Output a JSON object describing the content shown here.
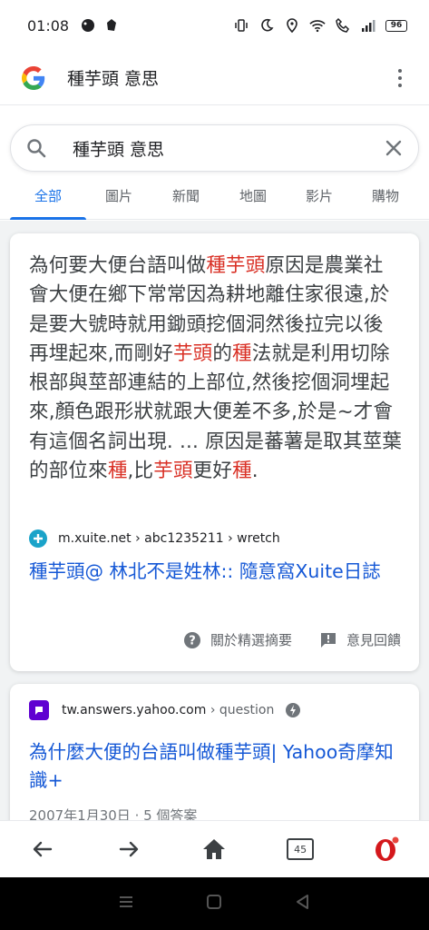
{
  "status_bar": {
    "time": "01:08",
    "battery": "96"
  },
  "header": {
    "query": "種芋頭 意思"
  },
  "search": {
    "value": "種芋頭 意思"
  },
  "tabs": [
    {
      "label": "全部"
    },
    {
      "label": "圖片"
    },
    {
      "label": "新聞"
    },
    {
      "label": "地圖"
    },
    {
      "label": "影片"
    },
    {
      "label": "購物"
    }
  ],
  "result1": {
    "snippet": [
      {
        "t": "為何要大便台語叫做"
      },
      {
        "t": "種芋頭",
        "hl": true
      },
      {
        "t": "原因是農業社會大便在鄉下常常因為耕地離住家很遠,於是要大號時就用鋤頭挖個洞然後拉完以後再埋起來,而剛好"
      },
      {
        "t": "芋頭",
        "hl": true
      },
      {
        "t": "的"
      },
      {
        "t": "種",
        "hl": true
      },
      {
        "t": "法就是利用切除根部與莖部連結的上部位,然後挖個洞埋起來,顏色跟形狀就跟大便差不多,於是~才會有這個名詞出現. ... 原因是蕃薯是取其莖葉的部位來"
      },
      {
        "t": "種",
        "hl": true
      },
      {
        "t": ",比"
      },
      {
        "t": "芋頭",
        "hl": true
      },
      {
        "t": "更好"
      },
      {
        "t": "種",
        "hl": true
      },
      {
        "t": "."
      }
    ],
    "source_url": "m.xuite.net › abc1235211 › wretch",
    "title": "種芋頭@ 林北不是姓林:: 隨意窩Xuite日誌",
    "about_label": "關於精選摘要",
    "feedback_label": "意見回饋"
  },
  "result2": {
    "source_url": "tw.answers.yahoo.com",
    "source_path": " › question",
    "title": "為什麼大便的台語叫做種芋頭| Yahoo奇摩知識+",
    "date_line": "2007年1月30日 · 5 個答案"
  },
  "bottom_nav": {
    "tab_count": "45"
  },
  "colors": {
    "link": "#1558d6",
    "highlight": "#d93025",
    "active_tab": "#1a73e8"
  }
}
